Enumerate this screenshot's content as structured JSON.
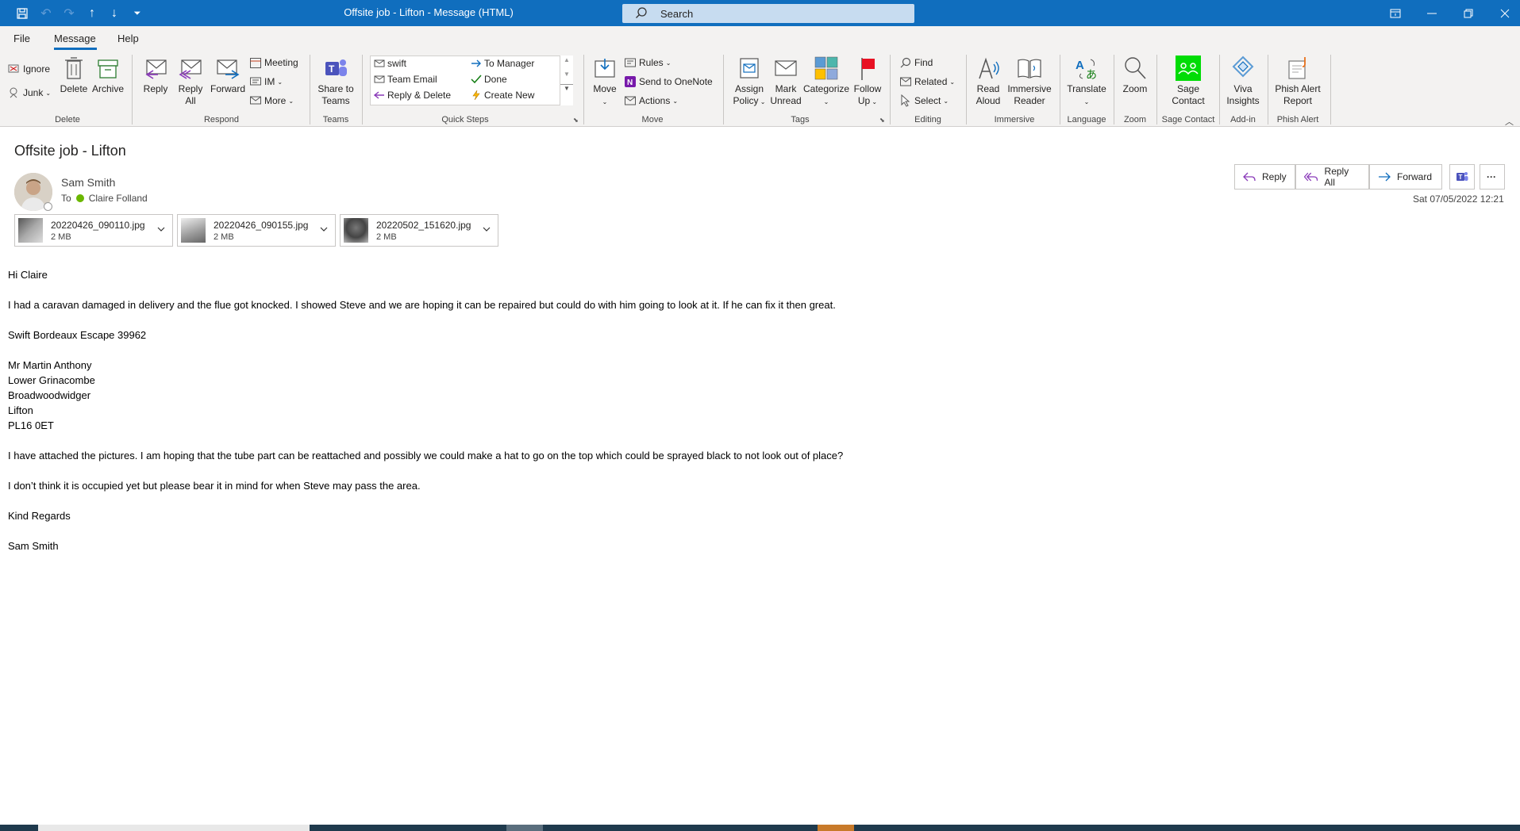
{
  "window": {
    "title": "Offsite job - Lifton  -  Message (HTML)",
    "search_placeholder": "Search"
  },
  "menu": {
    "tabs": [
      "File",
      "Message",
      "Help"
    ],
    "active": "Message"
  },
  "ribbon": {
    "delete_group": {
      "label": "Delete",
      "ignore": "Ignore",
      "junk": "Junk",
      "delete": "Delete",
      "archive": "Archive"
    },
    "respond_group": {
      "label": "Respond",
      "reply": "Reply",
      "reply_all_1": "Reply",
      "reply_all_2": "All",
      "forward": "Forward",
      "meeting": "Meeting",
      "im": "IM",
      "more": "More"
    },
    "teams_group": {
      "label": "Teams",
      "share_1": "Share to",
      "share_2": "Teams"
    },
    "quick_steps_group": {
      "label": "Quick Steps",
      "items": [
        "swift",
        "To Manager",
        "Team Email",
        "Done",
        "Reply & Delete",
        "Create New"
      ]
    },
    "move_group": {
      "label": "Move",
      "move": "Move",
      "rules": "Rules",
      "onenote": "Send to OneNote",
      "actions": "Actions"
    },
    "tags_group": {
      "label": "Tags",
      "assign_1": "Assign",
      "assign_2": "Policy",
      "mark_1": "Mark",
      "mark_2": "Unread",
      "categorize": "Categorize",
      "follow_1": "Follow",
      "follow_2": "Up"
    },
    "editing_group": {
      "label": "Editing",
      "find": "Find",
      "related": "Related",
      "select": "Select"
    },
    "immersive_group": {
      "label": "Immersive",
      "read_1": "Read",
      "read_2": "Aloud",
      "imm_1": "Immersive",
      "imm_2": "Reader"
    },
    "language_group": {
      "label": "Language",
      "translate": "Translate"
    },
    "zoom_group": {
      "label": "Zoom",
      "zoom": "Zoom"
    },
    "sage_group": {
      "label": "Sage Contact",
      "sage_1": "Sage",
      "sage_2": "Contact"
    },
    "addin_group": {
      "label": "Add-in",
      "viva_1": "Viva",
      "viva_2": "Insights"
    },
    "phish_group": {
      "label": "Phish Alert",
      "phish_1": "Phish Alert",
      "phish_2": "Report"
    }
  },
  "message": {
    "subject": "Offsite job - Lifton",
    "sender": "Sam Smith",
    "to_label": "To",
    "recipient": "Claire Folland",
    "datetime": "Sat 07/05/2022 12:21",
    "actions": {
      "reply": "Reply",
      "reply_all": "Reply All",
      "forward": "Forward"
    },
    "attachments": [
      {
        "name": "20220426_090110.jpg",
        "size": "2 MB"
      },
      {
        "name": "20220426_090155.jpg",
        "size": "2 MB"
      },
      {
        "name": "20220502_151620.jpg",
        "size": "2 MB"
      }
    ],
    "body": {
      "greeting": "Hi Claire",
      "p1": "I had a caravan damaged in delivery and the flue got knocked. I showed Steve and we are hoping it can be repaired but could do with him going to look at it. If he can fix it then great.",
      "p2": "Swift Bordeaux Escape 39962",
      "addr1": "Mr Martin Anthony",
      "addr2": "Lower Grinacombe",
      "addr3": "Broadwoodwidger",
      "addr4": "Lifton",
      "addr5": "PL16 0ET",
      "p3": "I have attached the pictures. I am hoping that the tube part can be reattached and possibly we could make a hat to go on the top which could be sprayed black to not look out of place?",
      "p4": "I don’t think it is occupied yet but please bear it in mind for when Steve may pass the area.",
      "closing": "Kind Regards",
      "signature": "Sam Smith"
    }
  },
  "colors": {
    "titlebar": "#106ebe",
    "ribbon_bg": "#f3f2f1",
    "accent": "#106ebe"
  }
}
